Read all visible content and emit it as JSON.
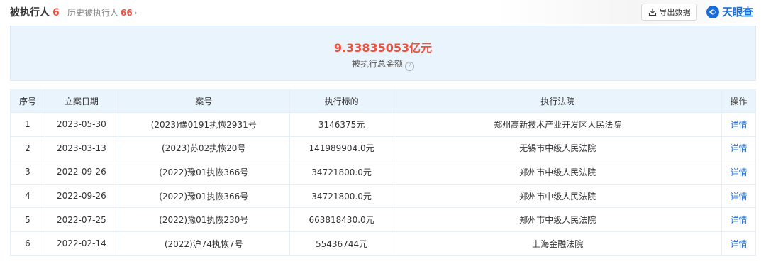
{
  "header": {
    "title": "被执行人",
    "title_count": "6",
    "history_label": "历史被执行人",
    "history_count": "66",
    "history_chevron": "›",
    "export_label": "导出数据",
    "brand_text": "天眼查"
  },
  "summary": {
    "amount": "9.33835053亿元",
    "label": "被执行总金额",
    "help_glyph": "?"
  },
  "table": {
    "columns": [
      "序号",
      "立案日期",
      "案号",
      "执行标的",
      "执行法院",
      "操作"
    ],
    "rows": [
      {
        "idx": "1",
        "date": "2023-05-30",
        "case": "(2023)豫0191执恢2931号",
        "amount": "3146375元",
        "court": "郑州高新技术产业开发区人民法院",
        "op": "详情"
      },
      {
        "idx": "2",
        "date": "2023-03-13",
        "case": "(2023)苏02执恢20号",
        "amount": "141989904.0元",
        "court": "无锡市中级人民法院",
        "op": "详情"
      },
      {
        "idx": "3",
        "date": "2022-09-26",
        "case": "(2022)豫01执恢366号",
        "amount": "34721800.0元",
        "court": "郑州市中级人民法院",
        "op": "详情"
      },
      {
        "idx": "4",
        "date": "2022-09-26",
        "case": "(2022)豫01执恢366号",
        "amount": "34721800.0元",
        "court": "郑州市中级人民法院",
        "op": "详情"
      },
      {
        "idx": "5",
        "date": "2022-07-25",
        "case": "(2022)豫01执恢230号",
        "amount": "663818430.0元",
        "court": "郑州市中级人民法院",
        "op": "详情"
      },
      {
        "idx": "6",
        "date": "2022-02-14",
        "case": "(2022)沪74执恢7号",
        "amount": "55436744元",
        "court": "上海金融法院",
        "op": "详情"
      }
    ]
  },
  "colors": {
    "accent_red": "#f04f3b",
    "link_blue": "#1a6cd6",
    "panel_blue": "#eaf4fd"
  },
  "icons": {
    "export": "download-icon",
    "brand": "tianyancha-logo-icon",
    "help": "question-circle-icon",
    "chevron": "chevron-right-icon"
  }
}
